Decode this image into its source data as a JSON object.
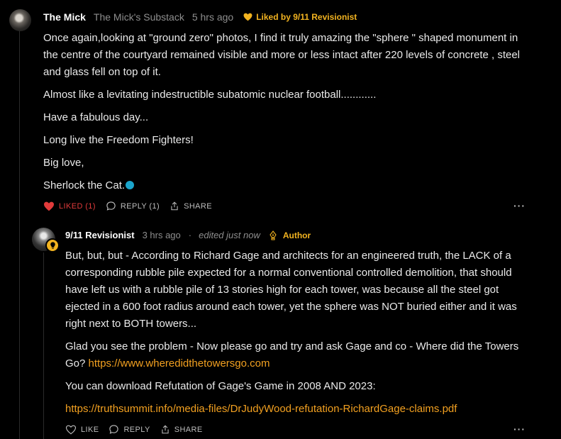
{
  "comment1": {
    "author": "The Mick",
    "publication": "The Mick's Substack",
    "time": "5 hrs ago",
    "liked_by": "Liked by 9/11 Revisionist",
    "paragraphs": [
      "Once again,looking at \"ground zero\" photos, I find it truly amazing the \"sphere \" shaped monument in the centre of the courtyard remained visible and more or less intact after 220 levels of concrete , steel and glass fell on top of it.",
      "Almost like a levitating indestructible subatomic nuclear football............",
      "Have a fabulous day...",
      "Long live the Freedom Fighters!",
      "Big love,",
      "Sherlock the Cat."
    ],
    "actions": {
      "like": "LIKED (1)",
      "reply": "REPLY (1)",
      "share": "SHARE"
    },
    "more": "···"
  },
  "reply1": {
    "author": "9/11 Revisionist",
    "time": "3 hrs ago",
    "separator": "·",
    "edited": "edited just now",
    "role": "Author",
    "p1": "But, but, but - According to Richard Gage and architects for an engineered truth, the LACK of a corresponding rubble pile expected for a normal conventional controlled demolition, that should have left us with a rubble pile of 13 stories high for each tower, was because all the steel got ejected in a 600 foot radius around each tower, yet the sphere was NOT buried either and it was right next to BOTH towers...",
    "p2_text": "Glad you see the problem - Now please go and try and ask Gage and co - Where did the Towers Go? ",
    "p2_link": "https://www.wheredidthetowersgo.com",
    "p3": "You can download Refutation of Gage's Game in 2008 AND 2023:",
    "p4_link": "https://truthsummit.info/media-files/DrJudyWood-refutation-RichardGage-claims.pdf",
    "actions": {
      "like": "LIKE",
      "reply": "REPLY",
      "share": "SHARE"
    },
    "more": "···"
  },
  "colors": {
    "accent": "#f2b320",
    "link": "#f2a020",
    "liked": "#e23b3b",
    "emoji_dot": "#1ba5cc"
  },
  "icons": [
    "heart-icon",
    "comment-icon",
    "share-icon",
    "pen-nib-icon",
    "lightbulb-icon",
    "more-icon"
  ]
}
